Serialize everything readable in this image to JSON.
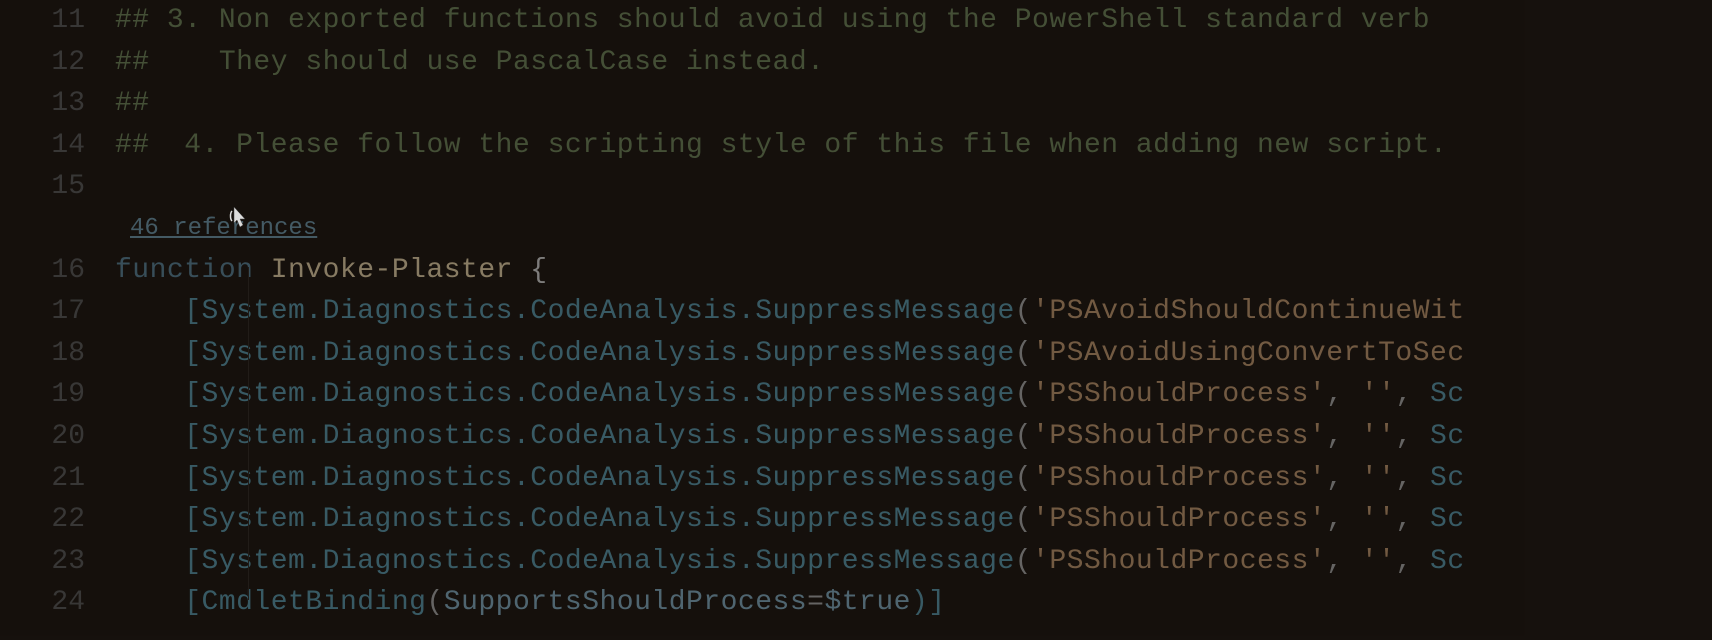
{
  "gutter": {
    "lines": [
      "11",
      "12",
      "13",
      "14",
      "15",
      "",
      "16",
      "17",
      "18",
      "19",
      "20",
      "21",
      "22",
      "23",
      "24"
    ]
  },
  "codelens": {
    "references": "46 references"
  },
  "code": {
    "l11_prefix": "## ",
    "l11_text": "3. Non exported functions should avoid using the PowerShell standard verb",
    "l12_prefix": "##    ",
    "l12_text": "They should use PascalCase instead.",
    "l13": "##",
    "l14_prefix": "##  ",
    "l14_text": "4. Please follow the scripting style of this file when adding new script.",
    "l15": "",
    "l16_kw": "function",
    "l16_name": " Invoke-Plaster ",
    "l16_brace": "{",
    "attr_open": "    [",
    "attr_type": "System.Diagnostics.CodeAnalysis.SuppressMessage",
    "attr_paren_open": "(",
    "l17_str": "'PSAvoidShouldContinueWit",
    "l18_str": "'PSAvoidUsingConvertToSec",
    "l19_str1": "'PSShouldProcess'",
    "l19_mid": ", ",
    "l19_str2": "''",
    "l19_mid2": ", ",
    "l19_tail": "Sc",
    "l20_str1": "'PSShouldProcess'",
    "l21_str1": "'PSShouldProcess'",
    "l22_str1": "'PSShouldProcess'",
    "l23_str1": "'PSShouldProcess'",
    "l24_open": "    [",
    "l24_type": "CmdletBinding",
    "l24_paren": "(",
    "l24_param": "SupportsShouldProcess",
    "l24_eq": "=",
    "l24_val": "$true",
    "l24_close": ")]"
  }
}
